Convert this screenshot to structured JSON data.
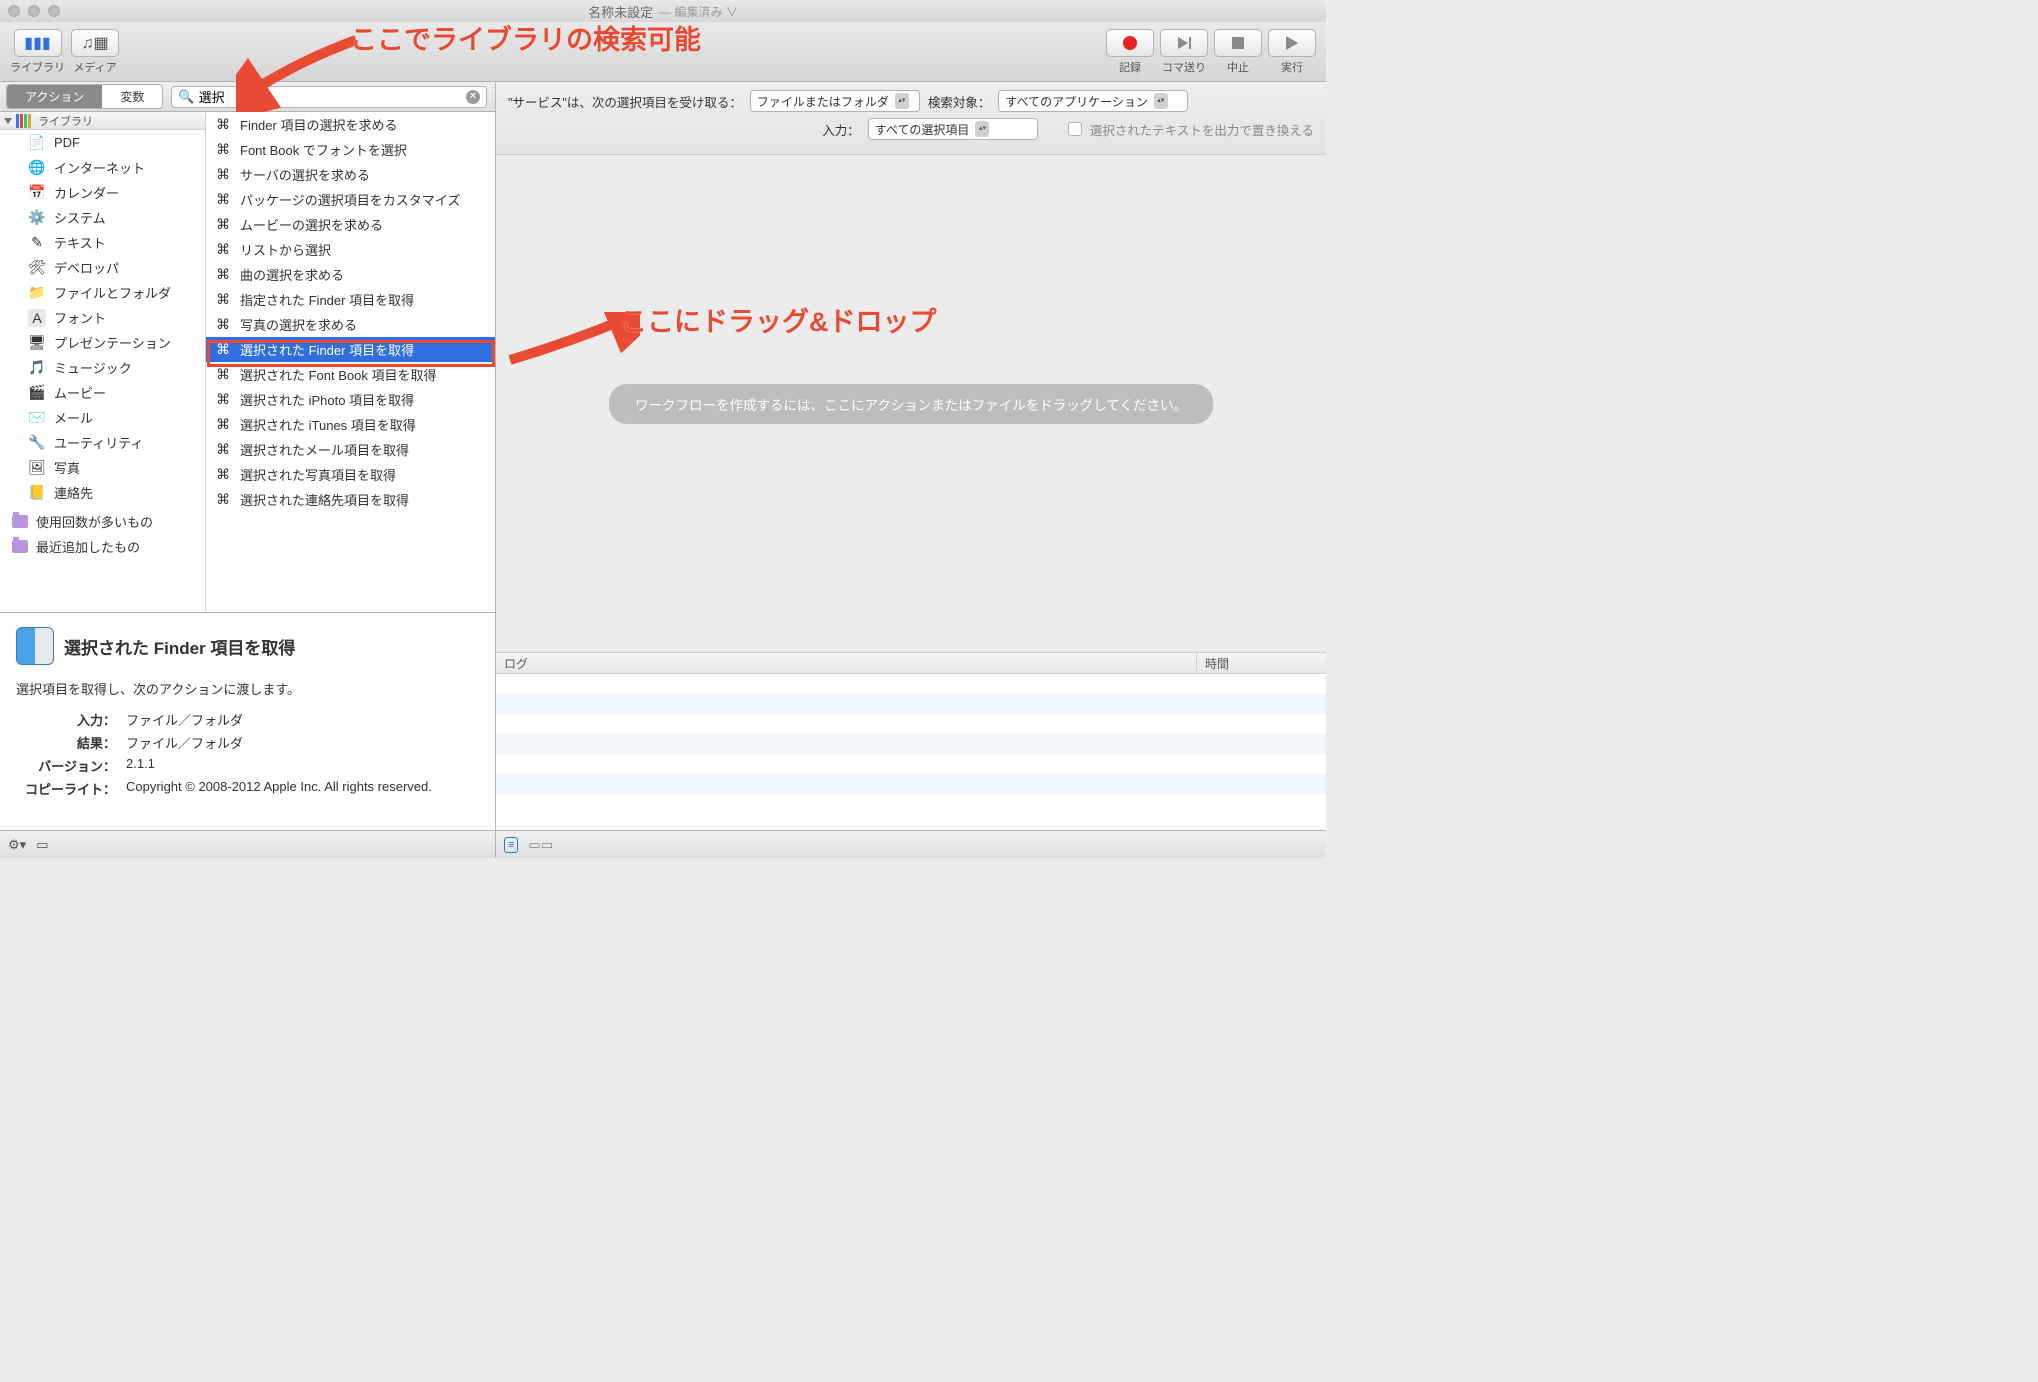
{
  "window": {
    "title": "名称未設定",
    "subtitle": "— 編集済み ∨"
  },
  "toolbar": {
    "library": "ライブラリ",
    "media": "メディア",
    "record": "記録",
    "step": "コマ送り",
    "stop": "中止",
    "run": "実行"
  },
  "segmented": {
    "action": "アクション",
    "variable": "変数"
  },
  "search": {
    "value": "選択"
  },
  "library": {
    "header": "ライブラリ",
    "items": [
      {
        "label": "PDF",
        "icon": "📄",
        "bg": ""
      },
      {
        "label": "インターネット",
        "icon": "🌐",
        "bg": ""
      },
      {
        "label": "カレンダー",
        "icon": "📅",
        "bg": ""
      },
      {
        "label": "システム",
        "icon": "⚙️",
        "bg": ""
      },
      {
        "label": "テキスト",
        "icon": "✎",
        "bg": ""
      },
      {
        "label": "デベロッパ",
        "icon": "🛠",
        "bg": ""
      },
      {
        "label": "ファイルとフォルダ",
        "icon": "📁",
        "bg": ""
      },
      {
        "label": "フォント",
        "icon": "A",
        "bg": "#e8e8e8"
      },
      {
        "label": "プレゼンテーション",
        "icon": "🖥",
        "bg": ""
      },
      {
        "label": "ミュージック",
        "icon": "🎵",
        "bg": ""
      },
      {
        "label": "ムービー",
        "icon": "🎬",
        "bg": ""
      },
      {
        "label": "メール",
        "icon": "✉️",
        "bg": ""
      },
      {
        "label": "ユーティリティ",
        "icon": "🔧",
        "bg": ""
      },
      {
        "label": "写真",
        "icon": "🖼",
        "bg": ""
      },
      {
        "label": "連絡先",
        "icon": "📒",
        "bg": ""
      }
    ],
    "smart": [
      {
        "label": "使用回数が多いもの"
      },
      {
        "label": "最近追加したもの"
      }
    ]
  },
  "actions": [
    {
      "label": "Finder 項目の選択を求める"
    },
    {
      "label": "Font Book でフォントを選択"
    },
    {
      "label": "サーバの選択を求める"
    },
    {
      "label": "パッケージの選択項目をカスタマイズ"
    },
    {
      "label": "ムービーの選択を求める"
    },
    {
      "label": "リストから選択"
    },
    {
      "label": "曲の選択を求める"
    },
    {
      "label": "指定された Finder 項目を取得"
    },
    {
      "label": "写真の選択を求める"
    },
    {
      "label": "選択された Finder 項目を取得",
      "selected": true
    },
    {
      "label": "選択された Font Book 項目を取得"
    },
    {
      "label": "選択された iPhoto 項目を取得"
    },
    {
      "label": "選択された iTunes 項目を取得"
    },
    {
      "label": "選択されたメール項目を取得"
    },
    {
      "label": "選択された写真項目を取得"
    },
    {
      "label": "選択された連絡先項目を取得"
    }
  ],
  "info": {
    "title": "選択された Finder 項目を取得",
    "desc": "選択項目を取得し、次のアクションに渡します。",
    "rows": [
      {
        "k": "入力：",
        "v": "ファイル／フォルダ"
      },
      {
        "k": "結果：",
        "v": "ファイル／フォルダ"
      },
      {
        "k": "バージョン：",
        "v": "2.1.1"
      },
      {
        "k": "コピーライト：",
        "v": "Copyright © 2008-2012 Apple Inc.  All rights reserved."
      }
    ]
  },
  "service": {
    "receives_lead": "\"サービス\"は、次の選択項目を受け取る：",
    "receives_value": "ファイルまたはフォルダ",
    "target_label": "検索対象：",
    "target_value": "すべてのアプリケーション",
    "input_label": "入力：",
    "input_value": "すべての選択項目",
    "replace_label": "選択されたテキストを出力で置き換える"
  },
  "canvas": {
    "placeholder": "ワークフローを作成するには、ここにアクションまたはファイルをドラッグしてください。"
  },
  "log": {
    "col1": "ログ",
    "col2": "時間"
  },
  "annotations": {
    "a1": "ここでライブラリの検索可能",
    "a2": "ここにドラッグ&ドロップ"
  }
}
